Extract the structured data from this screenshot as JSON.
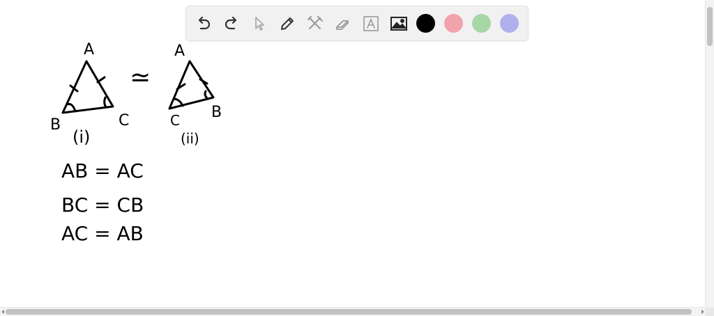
{
  "toolbar": {
    "tools": [
      "undo-icon",
      "redo-icon",
      "pointer-icon",
      "pencil-icon",
      "tools-icon",
      "eraser-icon",
      "text-icon",
      "image-icon"
    ],
    "colors": [
      "#000000",
      "#f0a3ab",
      "#a7d6a7",
      "#b0b0ee"
    ]
  },
  "drawing": {
    "triangle1": {
      "top": "A",
      "left": "B",
      "right": "C",
      "caption": "(i)"
    },
    "triangle2": {
      "top": "A",
      "left": "C",
      "right": "B",
      "caption": "(ii)"
    },
    "congruent_symbol": "≃",
    "equations": [
      "AB = AC",
      "BC = CB",
      "AC = AB"
    ]
  }
}
